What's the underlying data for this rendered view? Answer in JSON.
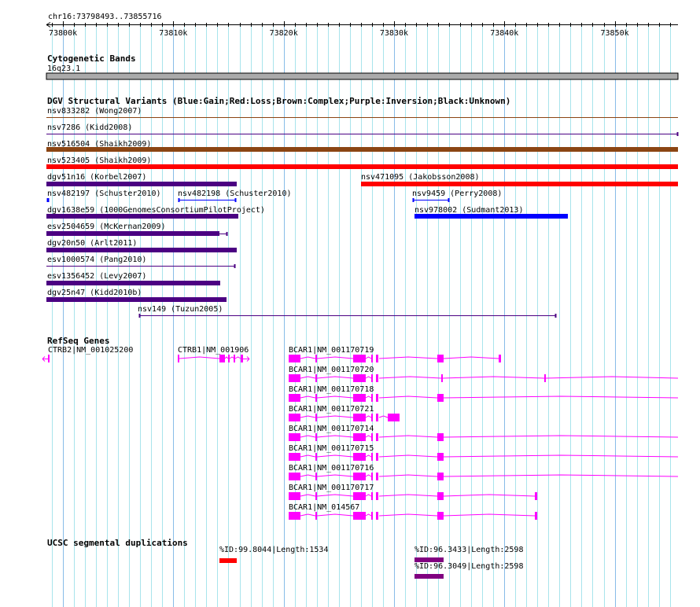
{
  "ruler": {
    "region": "chr16:73798493..73855716",
    "ticks": [
      "73800k",
      "73810k",
      "73820k",
      "73830k",
      "73840k",
      "73850k"
    ]
  },
  "cytoband": {
    "title": "Cytogenetic Bands",
    "band": "16q23.1"
  },
  "dgv": {
    "title": "DGV Structural Variants (Blue:Gain;Red:Loss;Brown:Complex;Purple:Inversion;Black:Unknown)",
    "items": [
      "nsv833282 (Wong2007)",
      "nsv7286 (Kidd2008)",
      "nsv516504 (Shaikh2009)",
      "nsv523405 (Shaikh2009)",
      "dgv51n16 (Korbel2007)",
      "nsv471095 (Jakobsson2008)",
      "nsv482197 (Schuster2010)",
      "nsv482198 (Schuster2010)",
      "nsv9459 (Perry2008)",
      "dgv1638e59 (1000GenomesConsortiumPilotProject)",
      "nsv978002 (Sudmant2013)",
      "esv2504659 (McKernan2009)",
      "dgv20n50 (Arlt2011)",
      "esv1000574 (Pang2010)",
      "esv1356452 (Levy2007)",
      "dgv25n47 (Kidd2010b)",
      "nsv149 (Tuzun2005)"
    ]
  },
  "refseq": {
    "title": "RefSeq Genes",
    "genes": [
      "CTRB2|NM_001025200",
      "CTRB1|NM_001906",
      "BCAR1|NM_001170719",
      "BCAR1|NM_001170720",
      "BCAR1|NM_001170718",
      "BCAR1|NM_001170721",
      "BCAR1|NM_001170714",
      "BCAR1|NM_001170715",
      "BCAR1|NM_001170716",
      "BCAR1|NM_001170717",
      "BCAR1|NM_014567"
    ]
  },
  "segdup": {
    "title": "UCSC segmental duplications",
    "items": [
      "%ID:99.8044|Length:1534",
      "%ID:96.3433|Length:2598",
      "%ID:96.3049|Length:2598"
    ]
  },
  "colors": {
    "gain": "#0000ff",
    "loss": "#ff0000",
    "complex": "#8b4513",
    "inversion": "#4b0082",
    "gene": "#ff00ff",
    "segdup_high": "#ff0000",
    "segdup": "#800080",
    "grid_minor": "#a8e4ec",
    "grid_major": "#88bce8"
  }
}
